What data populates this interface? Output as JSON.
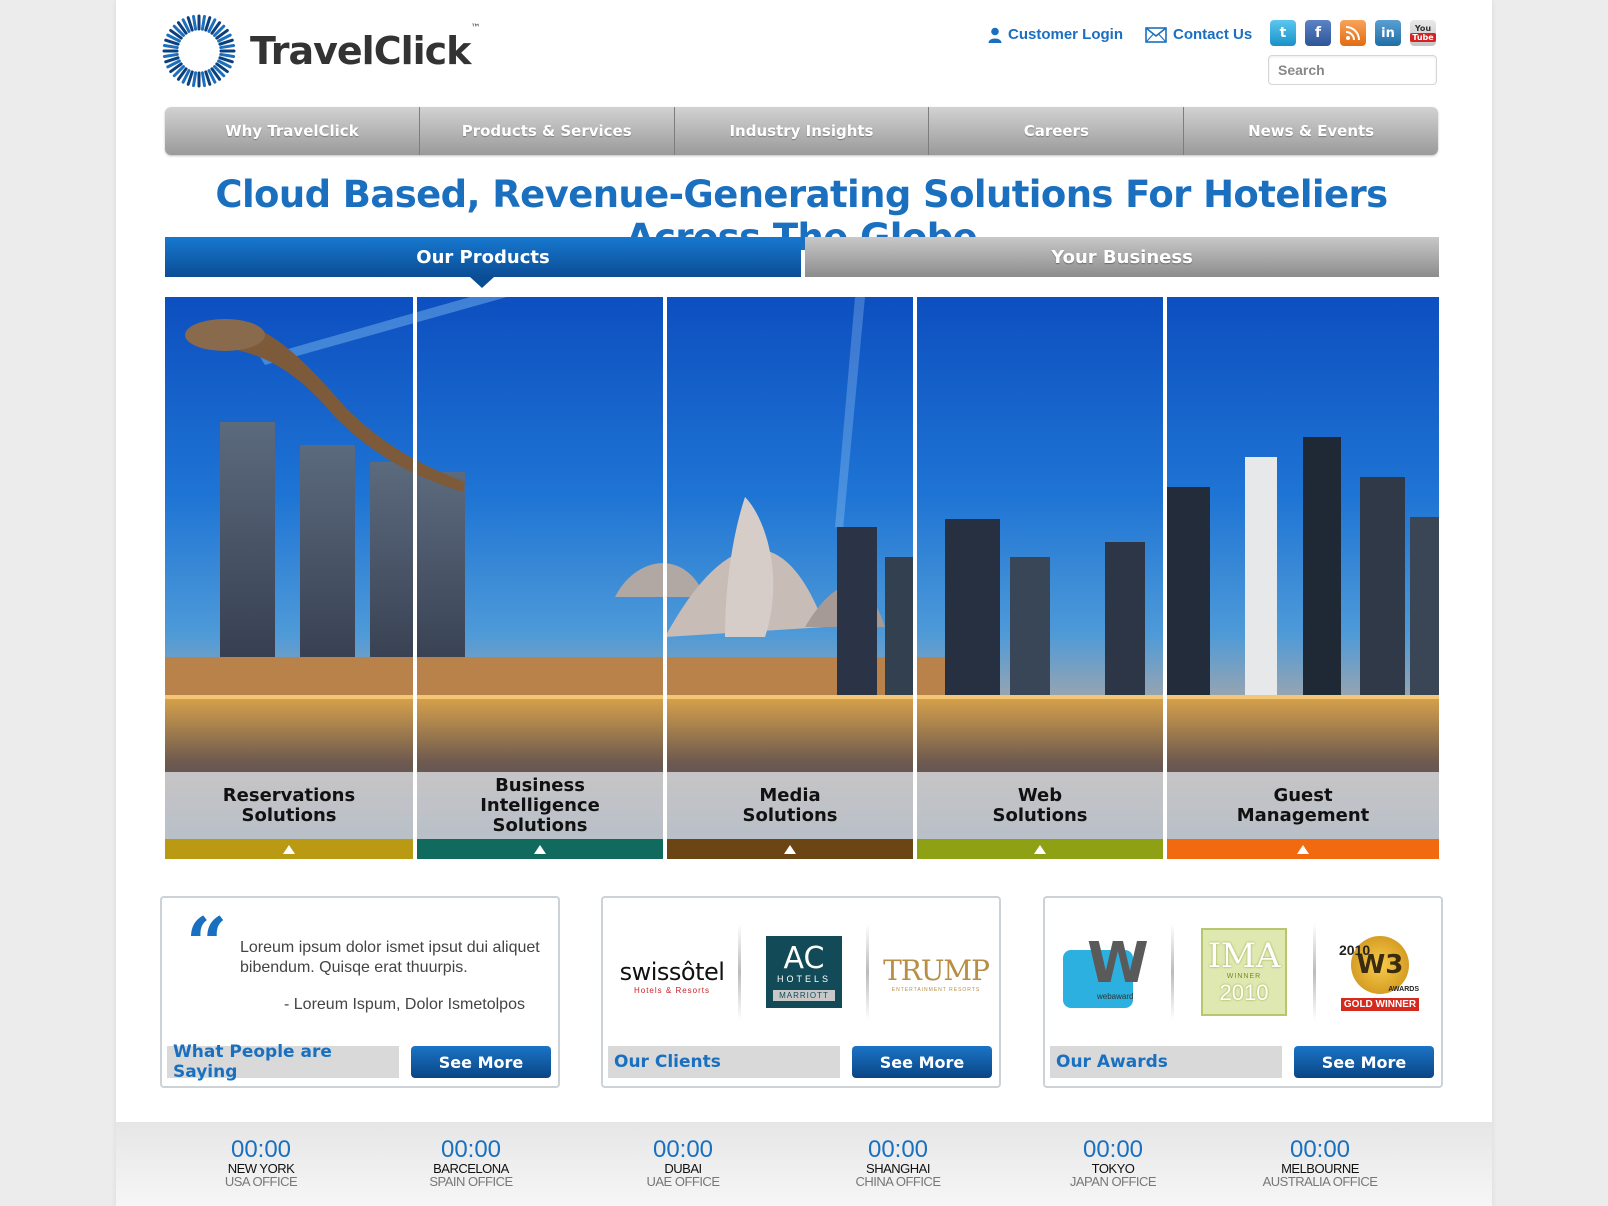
{
  "brand": {
    "name": "TravelClick",
    "tm": "™",
    "color": "#1a6fbf"
  },
  "header": {
    "customer_login": "Customer Login",
    "contact_us": "Contact Us",
    "search_placeholder": "Search",
    "social": [
      "twitter-icon",
      "facebook-icon",
      "rss-icon",
      "linkedin-icon",
      "youtube-icon"
    ]
  },
  "nav": {
    "items": [
      {
        "label": "Why TravelClick"
      },
      {
        "label": "Products & Services"
      },
      {
        "label": "Industry Insights"
      },
      {
        "label": "Careers"
      },
      {
        "label": "News & Events"
      }
    ]
  },
  "headline": "Cloud Based, Revenue-Generating Solutions For Hoteliers Across The Globe",
  "tabs": {
    "active": "Our Products",
    "inactive": "Your Business"
  },
  "products": [
    {
      "label": "Reservations\nSolutions",
      "color": "#b99a12"
    },
    {
      "label": "Business\nIntelligence\nSolutions",
      "color": "#116a5e"
    },
    {
      "label": "Media\nSolutions",
      "color": "#6b4514"
    },
    {
      "label": "Web\nSolutions",
      "color": "#8ea115"
    },
    {
      "label": "Guest\nManagement",
      "color": "#f26a10"
    }
  ],
  "testimonial": {
    "quote": "Loreum ipsum dolor ismet ipsut dui aliquet bibendum. Quisqe erat thuurpis.",
    "author": "- Loreum Ispum, Dolor Ismetolpos",
    "label": "What People are Saying",
    "button": "See More"
  },
  "clients": {
    "logos": {
      "swissotel": "swissôtel",
      "swissotel_sub": "Hotels & Resorts",
      "ac_main": "AC",
      "ac_hotels": "HOTELS",
      "ac_marriott": "MARRIOTT",
      "trump": "TRUMP",
      "trump_sub": "ENTERTAINMENT RESORTS"
    },
    "label": "Our Clients",
    "button": "See More"
  },
  "awards": {
    "logos": {
      "webaward_letter": "W",
      "webaward_text": "webaward",
      "ima_main": "IMA",
      "ima_winner": "WINNER",
      "ima_year": "2010",
      "w3_year": "2010",
      "w3_main": "W3",
      "w3_awards": "AWARDS",
      "w3_gold": "GOLD WINNER"
    },
    "label": "Our Awards",
    "button": "See More"
  },
  "clocks": [
    {
      "time": "00:00",
      "city": "NEW YORK",
      "office": "USA OFFICE"
    },
    {
      "time": "00:00",
      "city": "BARCELONA",
      "office": "SPAIN OFFICE"
    },
    {
      "time": "00:00",
      "city": "DUBAI",
      "office": "UAE OFFICE"
    },
    {
      "time": "00:00",
      "city": "SHANGHAI",
      "office": "CHINA OFFICE"
    },
    {
      "time": "00:00",
      "city": "TOKYO",
      "office": "JAPAN OFFICE"
    },
    {
      "time": "00:00",
      "city": "MELBOURNE",
      "office": "AUSTRALIA OFFICE"
    }
  ]
}
